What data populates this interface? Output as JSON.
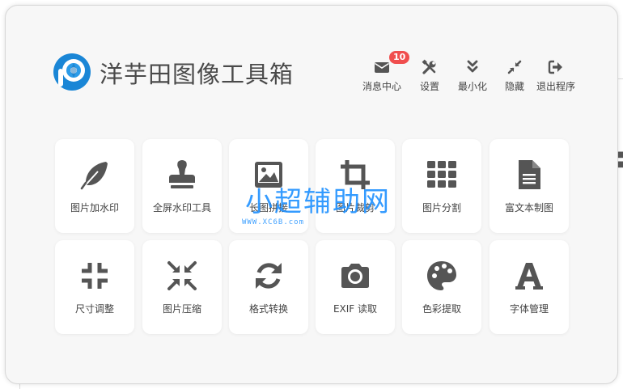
{
  "app": {
    "title": "洋芋田图像工具箱"
  },
  "toolbar": {
    "messages": {
      "label": "消息中心",
      "badge": "10",
      "icon": "envelope-icon"
    },
    "settings": {
      "label": "设置",
      "icon": "tools-icon"
    },
    "minimize": {
      "label": "最小化",
      "icon": "double-chevron-down-icon"
    },
    "hide": {
      "label": "隐藏",
      "icon": "compress-arrows-icon"
    },
    "exit": {
      "label": "退出程序",
      "icon": "sign-out-icon"
    }
  },
  "tools": [
    {
      "label": "图片加水印",
      "icon": "feather-icon"
    },
    {
      "label": "全屏水印工具",
      "icon": "stamp-icon"
    },
    {
      "label": "长图拼接",
      "icon": "image-icon"
    },
    {
      "label": "图片裁剪",
      "icon": "crop-icon"
    },
    {
      "label": "图片分割",
      "icon": "grid-icon"
    },
    {
      "label": "富文本制图",
      "icon": "document-icon"
    },
    {
      "label": "尺寸调整",
      "icon": "compress-icon"
    },
    {
      "label": "图片压缩",
      "icon": "compress-diagonal-icon"
    },
    {
      "label": "格式转换",
      "icon": "sync-icon"
    },
    {
      "label": "EXIF 读取",
      "icon": "camera-icon"
    },
    {
      "label": "色彩提取",
      "icon": "palette-icon"
    },
    {
      "label": "字体管理",
      "icon": "font-icon"
    }
  ],
  "watermark": {
    "text": "小超辅助网",
    "url": "WWW.XC6B.com"
  },
  "colors": {
    "icon": "#555555",
    "brand": "#1a86d6",
    "badge": "#f04e4e"
  }
}
